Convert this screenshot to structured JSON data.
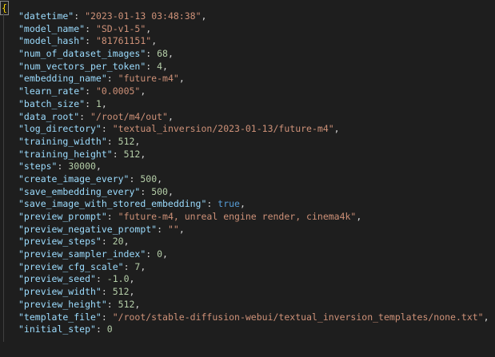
{
  "editor": {
    "open_brace": "{",
    "lines": [
      {
        "key": "\"datetime\"",
        "value": "\"2023-01-13 03:48:38\"",
        "type": "s",
        "trail": ","
      },
      {
        "key": "\"model_name\"",
        "value": "\"SD-v1-5\"",
        "type": "s",
        "trail": ","
      },
      {
        "key": "\"model_hash\"",
        "value": "\"81761151\"",
        "type": "s",
        "trail": ","
      },
      {
        "key": "\"num_of_dataset_images\"",
        "value": "68",
        "type": "n",
        "trail": ","
      },
      {
        "key": "\"num_vectors_per_token\"",
        "value": "4",
        "type": "n",
        "trail": ","
      },
      {
        "key": "\"embedding_name\"",
        "value": "\"future-m4\"",
        "type": "s",
        "trail": ","
      },
      {
        "key": "\"learn_rate\"",
        "value": "\"0.0005\"",
        "type": "s",
        "trail": ","
      },
      {
        "key": "\"batch_size\"",
        "value": "1",
        "type": "n",
        "trail": ","
      },
      {
        "key": "\"data_root\"",
        "value": "\"/root/m4/out\"",
        "type": "s",
        "trail": ","
      },
      {
        "key": "\"log_directory\"",
        "value": "\"textual_inversion/2023-01-13/future-m4\"",
        "type": "s",
        "trail": ","
      },
      {
        "key": "\"training_width\"",
        "value": "512",
        "type": "n",
        "trail": ","
      },
      {
        "key": "\"training_height\"",
        "value": "512",
        "type": "n",
        "trail": ","
      },
      {
        "key": "\"steps\"",
        "value": "30000",
        "type": "n",
        "trail": ","
      },
      {
        "key": "\"create_image_every\"",
        "value": "500",
        "type": "n",
        "trail": ","
      },
      {
        "key": "\"save_embedding_every\"",
        "value": "500",
        "type": "n",
        "trail": ","
      },
      {
        "key": "\"save_image_with_stored_embedding\"",
        "value": "true",
        "type": "b",
        "trail": ","
      },
      {
        "key": "\"preview_prompt\"",
        "value": "\"future-m4, unreal engine render, cinema4k\"",
        "type": "s",
        "trail": ","
      },
      {
        "key": "\"preview_negative_prompt\"",
        "value": "\"\"",
        "type": "s",
        "trail": ","
      },
      {
        "key": "\"preview_steps\"",
        "value": "20",
        "type": "n",
        "trail": ","
      },
      {
        "key": "\"preview_sampler_index\"",
        "value": "0",
        "type": "n",
        "trail": ","
      },
      {
        "key": "\"preview_cfg_scale\"",
        "value": "7",
        "type": "n",
        "trail": ","
      },
      {
        "key": "\"preview_seed\"",
        "value": "-1.0",
        "type": "n",
        "trail": ","
      },
      {
        "key": "\"preview_width\"",
        "value": "512",
        "type": "n",
        "trail": ","
      },
      {
        "key": "\"preview_height\"",
        "value": "512",
        "type": "n",
        "trail": ","
      },
      {
        "key": "\"template_file\"",
        "value": "\"/root/stable-diffusion-webui/textual_inversion_templates/none.txt\"",
        "type": "s",
        "trail": ","
      },
      {
        "key": "\"initial_step\"",
        "value": "0",
        "type": "n",
        "trail": ""
      }
    ]
  },
  "colors": {
    "background": "#1e1e1e",
    "key": "#9cdcfe",
    "string": "#ce9178",
    "number": "#b5cea8",
    "boolean": "#569cd6",
    "brace": "#ffd700",
    "punctuation": "#d4d4d4"
  }
}
